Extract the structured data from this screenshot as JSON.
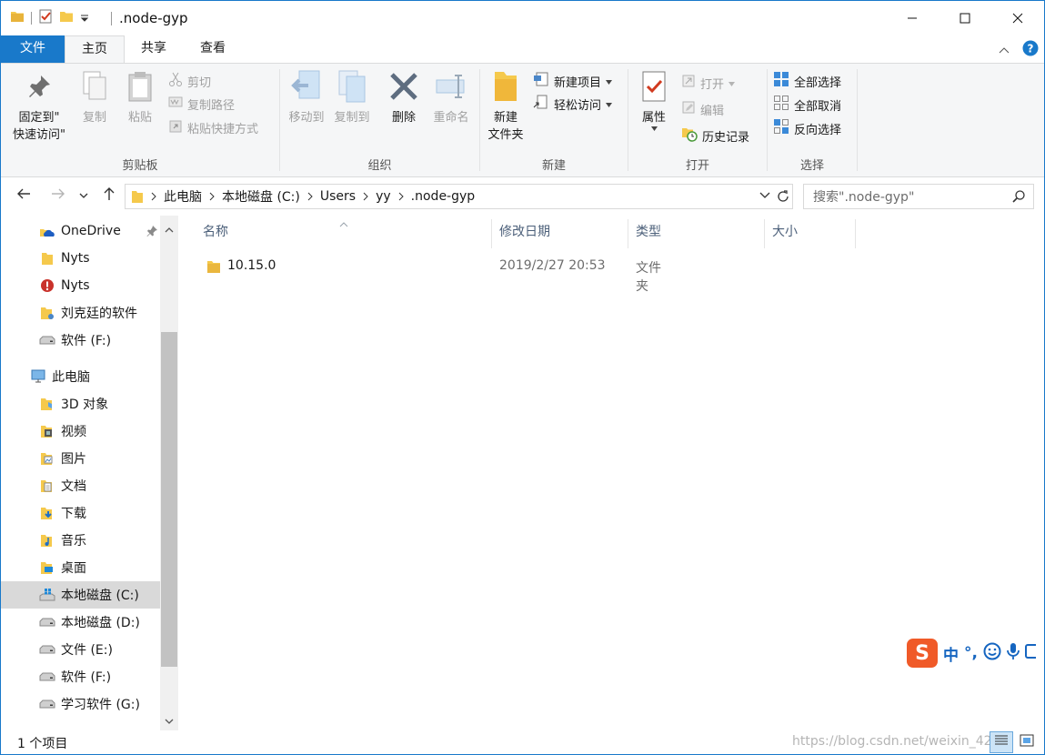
{
  "window": {
    "title": ".node-gyp"
  },
  "ribbon_tabs": {
    "file": "文件",
    "home": "主页",
    "share": "共享",
    "view": "查看"
  },
  "ribbon": {
    "clipboard": {
      "label": "剪贴板",
      "pin_line1": "固定到\"",
      "pin_line2": "快速访问\"",
      "copy": "复制",
      "paste": "粘贴",
      "cut": "剪切",
      "copy_path": "复制路径",
      "paste_shortcut": "粘贴快捷方式"
    },
    "organize": {
      "label": "组织",
      "move_to": "移动到",
      "copy_to": "复制到",
      "delete": "删除",
      "rename": "重命名"
    },
    "new": {
      "label": "新建",
      "new_folder_line1": "新建",
      "new_folder_line2": "文件夹",
      "new_item": "新建项目",
      "easy_access": "轻松访问"
    },
    "open": {
      "label": "打开",
      "properties": "属性",
      "open": "打开",
      "edit": "编辑",
      "history": "历史记录"
    },
    "select": {
      "label": "选择",
      "select_all": "全部选择",
      "select_none": "全部取消",
      "invert": "反向选择"
    }
  },
  "address": {
    "crumbs": [
      "此电脑",
      "本地磁盘 (C:)",
      "Users",
      "yy",
      ".node-gyp"
    ],
    "search_placeholder": "搜索\".node-gyp\""
  },
  "nav": {
    "items": [
      {
        "label": "OneDrive"
      },
      {
        "label": "Nyts"
      },
      {
        "label": "Nyts"
      },
      {
        "label": "刘克廷的软件"
      },
      {
        "label": "软件 (F:)"
      },
      {
        "label": "此电脑"
      },
      {
        "label": "3D 对象"
      },
      {
        "label": "视频"
      },
      {
        "label": "图片"
      },
      {
        "label": "文档"
      },
      {
        "label": "下载"
      },
      {
        "label": "音乐"
      },
      {
        "label": "桌面"
      },
      {
        "label": "本地磁盘 (C:)"
      },
      {
        "label": "本地磁盘 (D:)"
      },
      {
        "label": "文件 (E:)"
      },
      {
        "label": "软件 (F:)"
      },
      {
        "label": "学习软件 (G:)"
      }
    ]
  },
  "columns": {
    "name": "名称",
    "modified": "修改日期",
    "type": "类型",
    "size": "大小"
  },
  "files": [
    {
      "name": "10.15.0",
      "modified": "2019/2/27 20:53",
      "type": "文件夹",
      "size": ""
    }
  ],
  "status": {
    "count": "1 个项目",
    "watermark": "https://blog.csdn.net/weixin_42"
  },
  "ime": {
    "mode": "中",
    "punct": "°,"
  },
  "colors": {
    "accent": "#1979ca",
    "folder": "#f5c94c",
    "ime_brand": "#f05a28"
  }
}
